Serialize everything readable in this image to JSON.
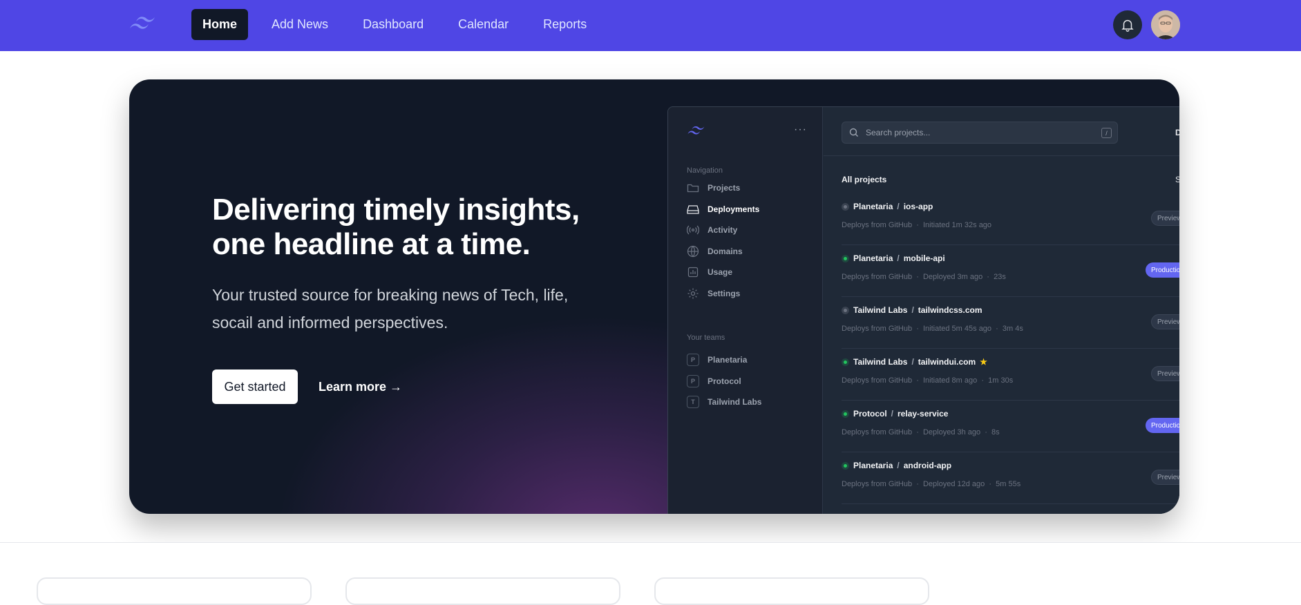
{
  "nav": {
    "logo_icon": "tailwind-wave-icon",
    "links": [
      "Home",
      "Add News",
      "Dashboard",
      "Calendar",
      "Reports"
    ],
    "active": "Home",
    "bell_icon": "bell-icon",
    "avatar_icon": "user-avatar"
  },
  "hero": {
    "title_line1": "Delivering timely insights,",
    "title_line2": "one headline at a time.",
    "subtitle": "Your trusted source for breaking news of Tech, life, socail and informed perspectives.",
    "primary_button": "Get started",
    "secondary_link": "Learn more →"
  },
  "app": {
    "dots": "···",
    "search_placeholder": "Search projects...",
    "search_shortcut": "/",
    "top_right_fragment": "D",
    "nav_heading": "Navigation",
    "nav_items": [
      {
        "label": "Projects",
        "icon": "folder-icon"
      },
      {
        "label": "Deployments",
        "icon": "server-icon"
      },
      {
        "label": "Activity",
        "icon": "signal-icon"
      },
      {
        "label": "Domains",
        "icon": "globe-icon"
      },
      {
        "label": "Usage",
        "icon": "chart-icon"
      },
      {
        "label": "Settings",
        "icon": "gear-icon"
      }
    ],
    "active_nav": "Deployments",
    "teams_heading": "Your teams",
    "teams": [
      {
        "initial": "P",
        "label": "Planetaria"
      },
      {
        "initial": "P",
        "label": "Protocol"
      },
      {
        "initial": "T",
        "label": "Tailwind Labs"
      }
    ],
    "list_heading": "All projects",
    "sort_fragment": "So",
    "projects": [
      {
        "team": "Planetaria",
        "name": "ios-app",
        "status": "gray",
        "meta": "Deploys from GitHub  ·  Initiated 1m 32s ago",
        "badge": "Preview",
        "badge_type": "preview",
        "star": false
      },
      {
        "team": "Planetaria",
        "name": "mobile-api",
        "status": "green",
        "meta": "Deploys from GitHub  ·  Deployed 3m ago  ·  23s",
        "badge": "Production",
        "badge_type": "production",
        "star": false
      },
      {
        "team": "Tailwind Labs",
        "name": "tailwindcss.com",
        "status": "gray",
        "meta": "Deploys from GitHub  ·  Initiated 5m 45s ago  ·  3m 4s",
        "badge": "Preview",
        "badge_type": "preview",
        "star": false
      },
      {
        "team": "Tailwind Labs",
        "name": "tailwindui.com",
        "status": "green",
        "meta": "Deploys from GitHub  ·  Initiated 8m ago  ·  1m 30s",
        "badge": "Preview",
        "badge_type": "preview",
        "star": true
      },
      {
        "team": "Protocol",
        "name": "relay-service",
        "status": "green",
        "meta": "Deploys from GitHub  ·  Deployed 3h ago  ·  8s",
        "badge": "Production",
        "badge_type": "production",
        "star": false
      },
      {
        "team": "Planetaria",
        "name": "android-app",
        "status": "green",
        "meta": "Deploys from GitHub  ·  Deployed 12d ago  ·  5m 55s",
        "badge": "Preview",
        "badge_type": "preview",
        "star": false
      }
    ]
  },
  "colors": {
    "nav_bg": "#4f46e5",
    "hero_bg": "#111827",
    "accent": "#6366f1",
    "status_green": "#22c55e",
    "status_gray": "#6b7280",
    "star": "#facc15"
  }
}
